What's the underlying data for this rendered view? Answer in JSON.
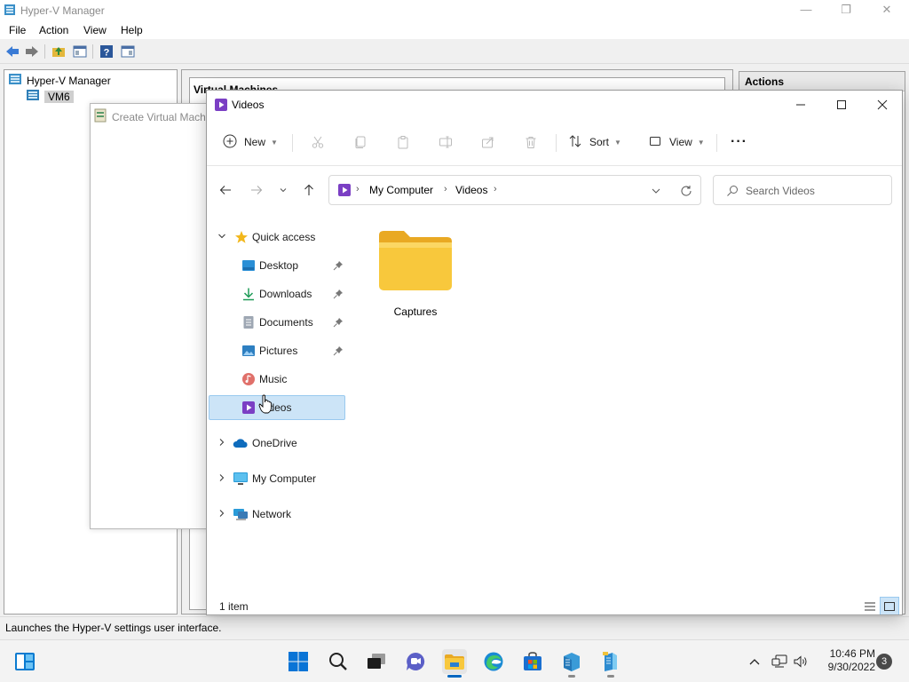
{
  "hyperv": {
    "title": "Hyper-V Manager",
    "menu": [
      "File",
      "Action",
      "View",
      "Help"
    ],
    "tree": {
      "root_label": "Hyper-V Manager",
      "child_label": "VM6"
    },
    "center_header": "Virtual Machines",
    "actions_header": "Actions",
    "status_text": "Launches the Hyper-V settings user interface."
  },
  "wizard": {
    "title": "Create Virtual Machi"
  },
  "explorer": {
    "title": "Videos",
    "commands": {
      "new_label": "New",
      "sort_label": "Sort",
      "view_label": "View",
      "more_label": "···"
    },
    "address": {
      "crumbs": [
        "My Computer",
        "Videos"
      ]
    },
    "search_placeholder": "Search Videos",
    "sidebar": {
      "quick_access": "Quick access",
      "items": [
        "Desktop",
        "Downloads",
        "Documents",
        "Pictures",
        "Music",
        "Videos"
      ],
      "onedrive": "OneDrive",
      "my_computer": "My Computer",
      "network": "Network"
    },
    "content": {
      "folders": [
        "Captures"
      ]
    },
    "status": {
      "item_count": "1 item"
    }
  },
  "taskbar": {
    "time": "10:46 PM",
    "date": "9/30/2022",
    "notification_count": "3"
  },
  "colors": {
    "accent": "#0067c0",
    "selection": "#cce4f7",
    "folder_yellow": "#f8c83c",
    "videos_purple": "#7b3fc4"
  }
}
